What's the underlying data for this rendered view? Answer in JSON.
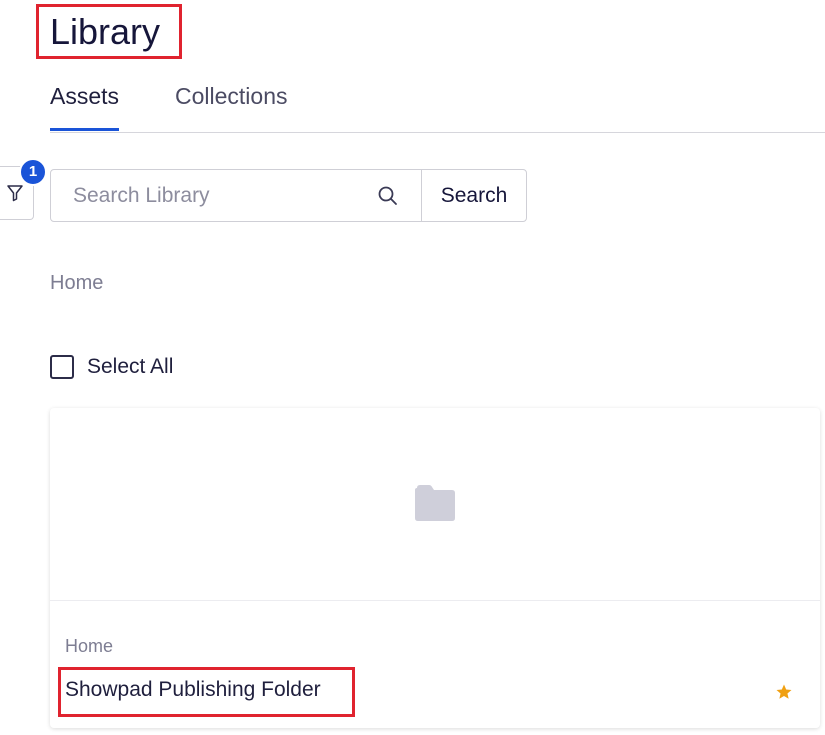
{
  "header": {
    "title": "Library"
  },
  "tabs": [
    {
      "label": "Assets",
      "active": true
    },
    {
      "label": "Collections",
      "active": false
    }
  ],
  "filter": {
    "icon": "filter-icon",
    "badge_count": "1",
    "badge_color": "#1a54d8"
  },
  "search": {
    "placeholder": "Search Library",
    "value": "",
    "icon": "search-icon",
    "button_label": "Search"
  },
  "breadcrumb": {
    "label": "Home"
  },
  "select_all": {
    "label": "Select All",
    "checked": false
  },
  "items": [
    {
      "type": "folder",
      "icon": "folder-icon",
      "path": "Home",
      "name": "Showpad Publishing Folder",
      "favorite": true,
      "favorite_icon": "star-icon",
      "favorite_color": "#f0a012"
    }
  ],
  "colors": {
    "accent": "#1a54d8",
    "highlight_border": "#e0232f",
    "star": "#f0a012",
    "folder": "#cfcfda"
  }
}
